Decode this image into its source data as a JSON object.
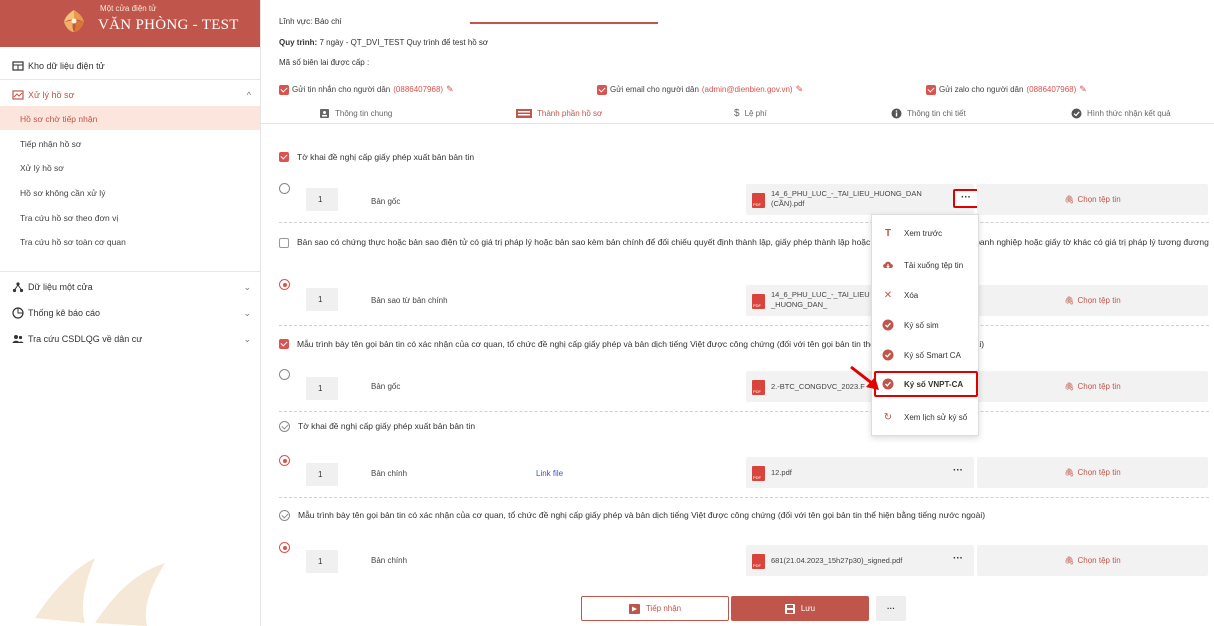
{
  "brand": {
    "subtitle": "Một cửa điện tử",
    "title": "VĂN PHÒNG - TEST"
  },
  "sidebar": {
    "kho": "Kho dữ liệu điện tử",
    "xuly": "Xử lý hồ sơ",
    "sub": [
      "Hồ sơ chờ tiếp nhận",
      "Tiếp nhận hồ sơ",
      "Xử lý hồ sơ",
      "Hồ sơ không cần xử lý",
      "Tra cứu hồ sơ theo đơn vị",
      "Tra cứu hồ sơ toàn cơ quan"
    ],
    "dulieu": "Dữ liệu một cửa",
    "thongke": "Thống kê báo cáo",
    "tracuu": "Tra cứu CSDLQG về dân cư"
  },
  "info": {
    "linhvuc_label": "Lĩnh vực:",
    "linhvuc_value": "Báo chí",
    "quytrinh_label": "Quy trình:",
    "quytrinh_value": "7 ngày - QT_DVI_TEST Quy trình để test hồ sơ",
    "bienlai_label": "Mã số biên lai được cấp :"
  },
  "notify": {
    "sms_label": "Gửi tin nhắn cho người dân",
    "sms_value": "(0886407968)",
    "email_label": "Gửi email cho người dân",
    "email_value": "(admin@dienbien.gov.vn)",
    "zalo_label": "Gửi zalo cho người dân",
    "zalo_value": "(0886407968)"
  },
  "tabs": [
    "Thông tin chung",
    "Thành phần hồ sơ",
    "Lệ phí",
    "Thông tin chi tiết",
    "Hình thức nhận kết quả"
  ],
  "sections": [
    "Tờ khai đề nghị cấp giấy phép xuất bản bản tin",
    "Bản sao có chứng thực hoặc bản sao điện tử có giá trị pháp lý hoặc bản sao kèm bản chính để đối chiếu quyết định thành lập, giấy phép thành lập hoặc giấy chứng nhận đăng ký doanh nghiệp hoặc giấy tờ khác có giá trị pháp lý tương đương",
    "Mẫu trình bày tên gọi bản tin có xác nhận của cơ quan, tổ chức đề nghị cấp giấy phép và bản dịch tiếng Việt được công chứng (đối với tên gọi bản tin thể hiện bằng tiếng nước ngoài)",
    "Tờ khai đề nghị cấp giấy phép xuất bản bản tin",
    "Mẫu trình bày tên gọi bản tin có xác nhận của cơ quan, tổ chức đề nghị cấp giấy phép và bản dịch tiếng Việt được công chứng (đối với tên gọi bản tin thể hiện bằng tiếng nước ngoài)"
  ],
  "rows": [
    {
      "num": "1",
      "kind": "Bản gốc",
      "file": "14_6_PHU_LUC_-_TAI_LIEU_HUONG_DAN (CẦN).pdf",
      "link": ""
    },
    {
      "num": "1",
      "kind": "Bản sao từ bản chính",
      "file": "14_6_PHU_LUC_-_TAI_LIEU_HUONG_DAN_",
      "link": ""
    },
    {
      "num": "1",
      "kind": "Bản gốc",
      "file": "2.-BTC_CONGDVC_2023.F",
      "link": ""
    },
    {
      "num": "1",
      "kind": "Bản chính",
      "file": "12.pdf",
      "link": "Link file"
    },
    {
      "num": "1",
      "kind": "Bản chính",
      "file": "681(21.04.2023_15h27p30)_signed.pdf",
      "link": ""
    }
  ],
  "choose_label": "Chọn tệp tin",
  "menu": [
    "Xem trước",
    "Tải xuống tệp tin",
    "Xóa",
    "Ký số sim",
    "Ký số Smart CA",
    "Ký số VNPT-CA",
    "Xem lịch sử ký số"
  ],
  "buttons": {
    "receive": "Tiếp nhận",
    "save": "Lưu",
    "more": "···"
  },
  "dots": "···",
  "colors": {
    "primary": "#c0564b",
    "danger": "#d9534f",
    "highlight": "#e00000"
  }
}
